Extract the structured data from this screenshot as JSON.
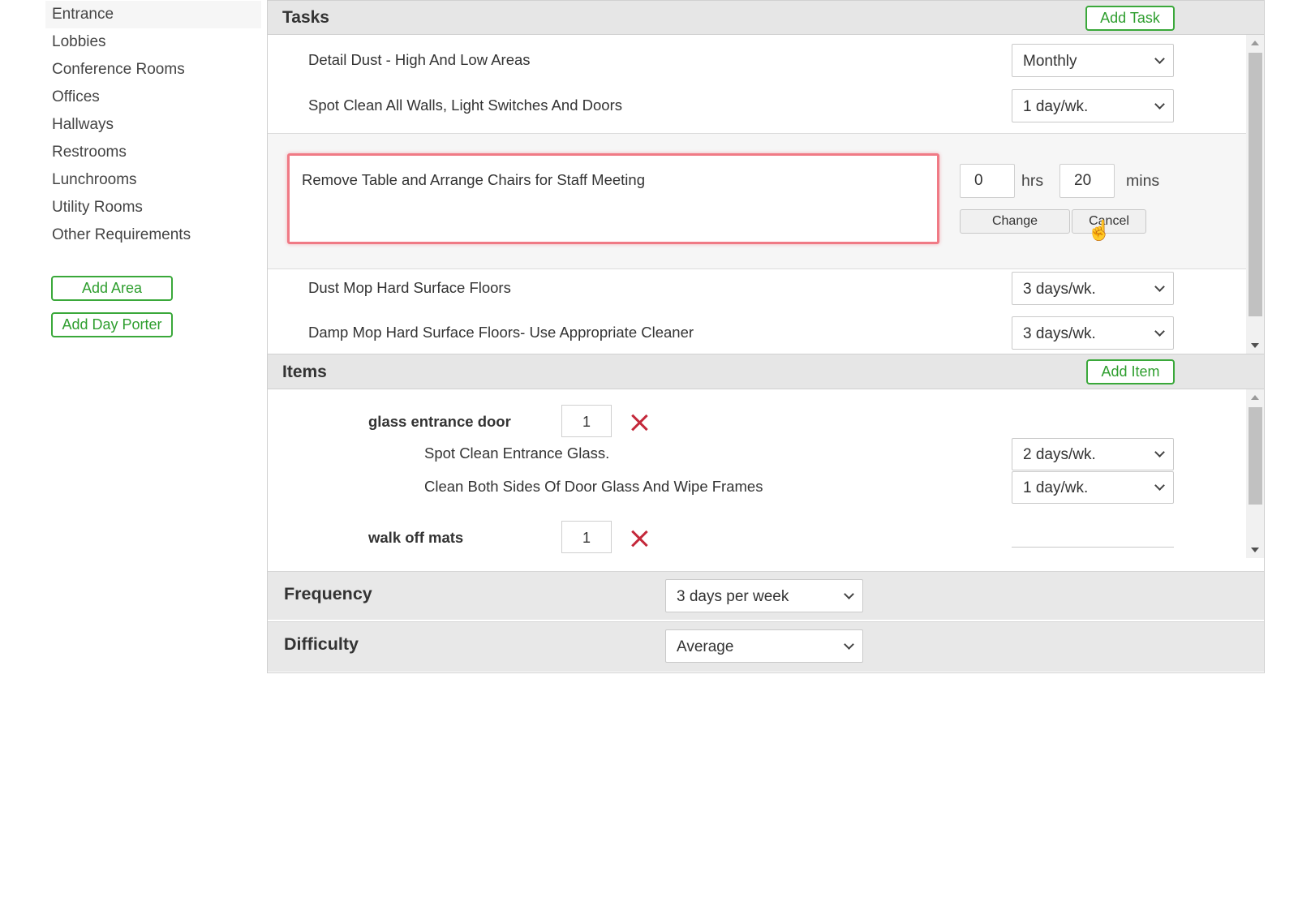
{
  "sidebar": {
    "items": [
      {
        "label": "Entrance",
        "active": true
      },
      {
        "label": "Lobbies"
      },
      {
        "label": "Conference Rooms"
      },
      {
        "label": "Offices"
      },
      {
        "label": "Hallways"
      },
      {
        "label": "Restrooms"
      },
      {
        "label": "Lunchrooms"
      },
      {
        "label": "Utility Rooms"
      },
      {
        "label": "Other Requirements"
      }
    ],
    "add_area_label": "Add Area",
    "add_day_porter_label": "Add Day Porter"
  },
  "tasks": {
    "title": "Tasks",
    "add_label": "Add Task",
    "rows": [
      {
        "label": "Detail Dust - High And Low Areas",
        "frequency": "Monthly"
      },
      {
        "label": "Spot Clean All Walls, Light Switches And Doors",
        "frequency": "1 day/wk."
      }
    ],
    "edit": {
      "text": "Remove Table and Arrange Chairs for Staff Meeting",
      "hours": "0",
      "hours_unit": "hrs",
      "minutes": "20",
      "minutes_unit": "mins",
      "change_label": "Change",
      "cancel_label": "Cancel"
    },
    "rows_after": [
      {
        "label": "Dust Mop Hard Surface Floors",
        "frequency": "3 days/wk."
      },
      {
        "label": "Damp Mop Hard Surface Floors- Use Appropriate Cleaner",
        "frequency": "3 days/wk."
      }
    ]
  },
  "items": {
    "title": "Items",
    "add_label": "Add Item",
    "list": [
      {
        "name": "glass entrance door",
        "qty": "1",
        "tasks": [
          {
            "label": "Spot Clean Entrance Glass.",
            "frequency": "2 days/wk."
          },
          {
            "label": "Clean Both Sides Of Door Glass And Wipe Frames",
            "frequency": "1 day/wk."
          }
        ]
      },
      {
        "name": "walk off mats",
        "qty": "1"
      }
    ]
  },
  "frequency": {
    "label": "Frequency",
    "value": "3 days per week"
  },
  "difficulty": {
    "label": "Difficulty",
    "value": "Average"
  },
  "colors": {
    "accent_green": "#2e9e2e",
    "error_outline": "#f07a85",
    "remove_red": "#c4283a"
  },
  "icons": {
    "remove": "close-x-icon",
    "dropdown": "chevron-down-icon",
    "cursor": "hand-pointer-icon"
  }
}
